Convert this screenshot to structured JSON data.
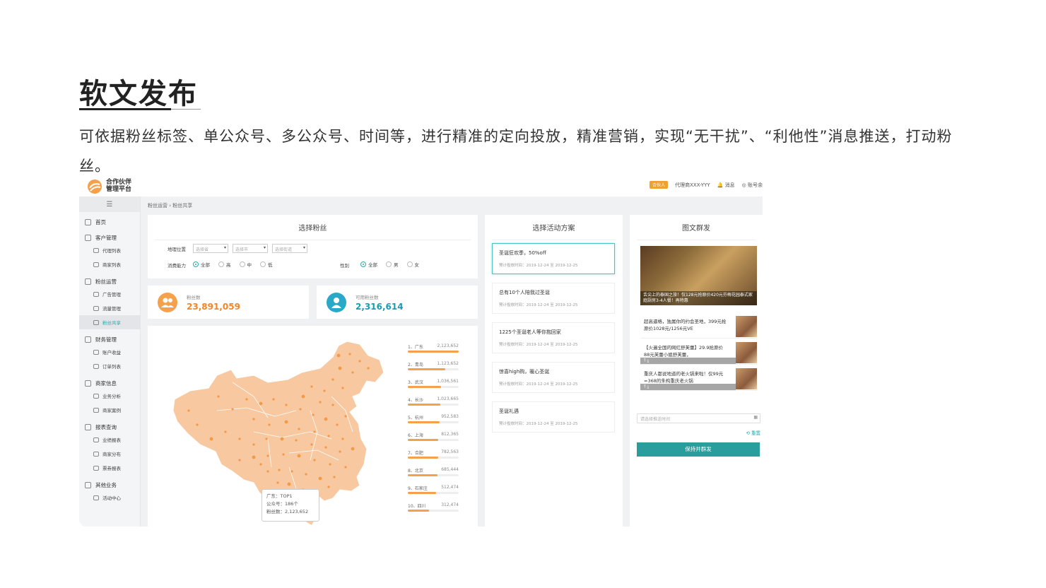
{
  "page": {
    "title": "软文发布",
    "description": "可依据粉丝标签、单公众号、多公众号、时间等，进行精准的定向投放，精准营销，实现“无干扰”、“利他性”消息推送，打动粉丝。"
  },
  "app": {
    "logo_line1": "合作伙伴",
    "logo_line2": "管理平台",
    "partner_badge": "合伙人",
    "agent_name": "代理商XXX-YYY",
    "messages": "消息",
    "account": "账号余",
    "colors": {
      "accent": "#2a9d9d",
      "orange": "#f5a04a",
      "blue": "#2aa8c8"
    }
  },
  "sidebar": [
    {
      "label": "首页",
      "icon": "home-icon",
      "children": []
    },
    {
      "label": "客户管理",
      "icon": "customer-icon",
      "children": [
        "代理列表",
        "商家列表"
      ]
    },
    {
      "label": "粉丝运营",
      "icon": "fans-icon",
      "children": [
        "广告管理",
        "流量管理",
        "粉丝共享"
      ]
    },
    {
      "label": "财务管理",
      "icon": "finance-icon",
      "children": [
        "账户收益",
        "订单列表"
      ]
    },
    {
      "label": "商家信息",
      "icon": "merchant-icon",
      "children": [
        "业务分析",
        "商家案例"
      ]
    },
    {
      "label": "报表查询",
      "icon": "report-icon",
      "children": [
        "业绩报表",
        "商家分布",
        "票券报表"
      ]
    },
    {
      "label": "其他业务",
      "icon": "other-icon",
      "children": [
        "活动中心"
      ]
    }
  ],
  "breadcrumb": {
    "root": "粉丝运营",
    "current": "粉丝共享"
  },
  "select_fans": {
    "title": "选择粉丝",
    "location_label": "地理位置",
    "province_placeholder": "选择省",
    "city_placeholder": "选择市",
    "street_placeholder": "选择街道",
    "consumption_label": "消费能力",
    "consumption_options": [
      "全部",
      "高",
      "中",
      "低"
    ],
    "gender_label": "性别",
    "gender_options": [
      "全部",
      "男",
      "女"
    ]
  },
  "stats": {
    "fans_label": "粉丝数",
    "fans_value": "23,891,059",
    "available_label": "可用粉丝数",
    "available_value": "2,316,614"
  },
  "ranking": [
    {
      "rank": "1、",
      "city": "广东",
      "value": "2,123,652",
      "fill": 1.0
    },
    {
      "rank": "2、",
      "city": "青岛",
      "value": "1,123,652",
      "fill": 0.74
    },
    {
      "rank": "3、",
      "city": "武汉",
      "value": "1,036,561",
      "fill": 0.65
    },
    {
      "rank": "4、",
      "city": "长沙",
      "value": "1,023,665",
      "fill": 0.64
    },
    {
      "rank": "5、",
      "city": "杭州",
      "value": "952,583",
      "fill": 0.63
    },
    {
      "rank": "6、",
      "city": "上海",
      "value": "812,365",
      "fill": 0.6
    },
    {
      "rank": "7、",
      "city": "合肥",
      "value": "782,563",
      "fill": 0.6
    },
    {
      "rank": "8、",
      "city": "北京",
      "value": "685,444",
      "fill": 0.58
    },
    {
      "rank": "9、",
      "city": "石家庄",
      "value": "512,474",
      "fill": 0.56
    },
    {
      "rank": "10、",
      "city": "四川",
      "value": "312,474",
      "fill": 0.42
    }
  ],
  "tooltip": {
    "line1": "广东：TOP1",
    "line2": "公众号：186个",
    "line3": "粉丝数：2,123,652"
  },
  "plans": {
    "title": "选择活动方案",
    "items": [
      {
        "name": "圣诞狂欢季，50%off",
        "time": "预计投放时间：2019-12-24 至 2019-12-25"
      },
      {
        "name": "总有10个人陪我过圣诞",
        "time": "预计投放时间：2019-12-24 至 2019-12-25"
      },
      {
        "name": "1225个圣诞老人等你抱回家",
        "time": "预计投放时间：2019-12-24 至 2019-12-25"
      },
      {
        "name": "惊喜high购，暖心圣诞",
        "time": "预计投放时间：2019-12-24 至 2019-12-25"
      },
      {
        "name": "圣诞礼遇",
        "time": "预计投放时间：2019-12-24 至 2019-12-25"
      }
    ]
  },
  "broadcast": {
    "title": "图文群发",
    "hero_caption": "舌尖上的泰国之旅！仅128元抢原价420元芬梅花园泰式家庭厨房3-4人餐！再特惠",
    "items": [
      "超高逼格，独属你的约会圣地，399元抢原价1028元/1256元VE",
      "【火遍全国的网红舒芙蕾】29.9抢原价88元芙蕾小姐舒芙蕾，",
      "重庆人都说地道的老火锅来啦！仅99元=368的朱构重庆老火锅"
    ],
    "date_placeholder": "请选择推送时间",
    "reset_label": "重置",
    "send_label": "保持并群发"
  }
}
